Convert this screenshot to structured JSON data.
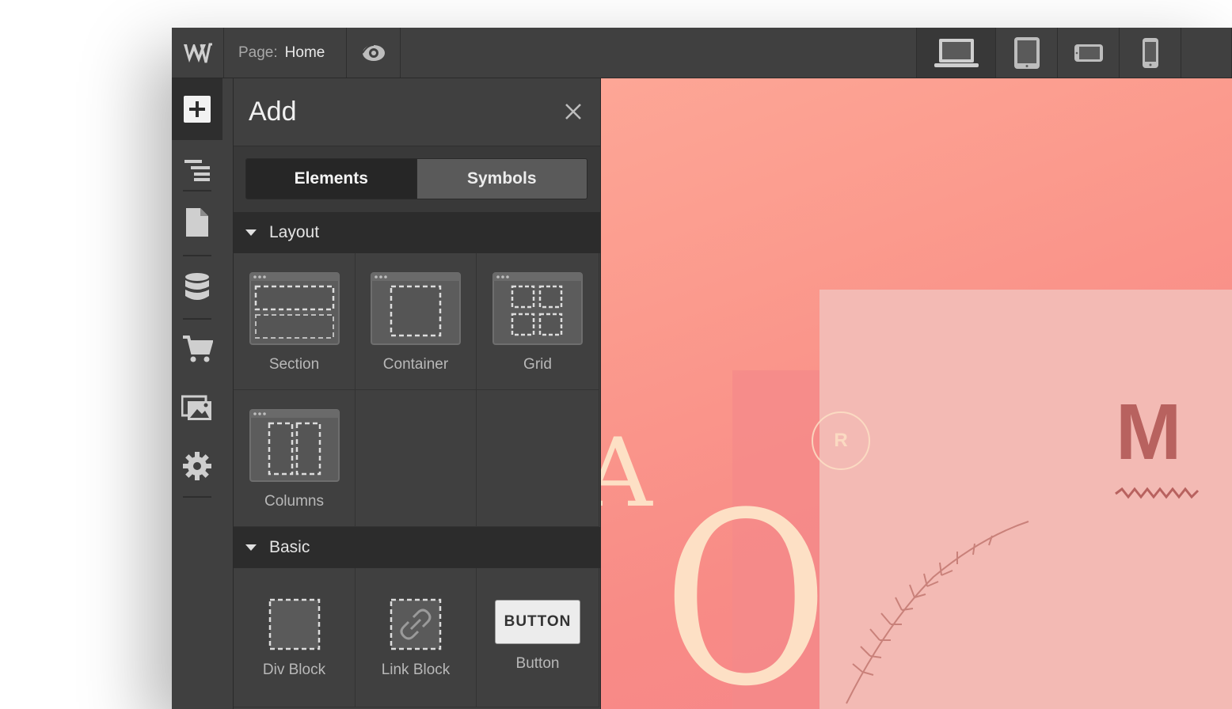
{
  "topbar": {
    "logo_text": "W",
    "page_label": "Page:",
    "page_name": "Home",
    "preview_icon": "eye-icon",
    "devices": [
      {
        "name": "desktop",
        "icon": "laptop-icon"
      },
      {
        "name": "tablet",
        "icon": "tablet-icon"
      },
      {
        "name": "mobile-landscape",
        "icon": "phone-landscape-icon"
      },
      {
        "name": "mobile-portrait",
        "icon": "phone-portrait-icon"
      }
    ]
  },
  "leftbar": {
    "items": [
      {
        "name": "add",
        "icon": "plus-icon"
      },
      {
        "name": "navigator",
        "icon": "navigator-icon"
      },
      {
        "name": "pages",
        "icon": "page-icon"
      },
      {
        "name": "cms",
        "icon": "database-icon"
      },
      {
        "name": "ecommerce",
        "icon": "cart-icon"
      },
      {
        "name": "assets",
        "icon": "images-icon"
      },
      {
        "name": "settings",
        "icon": "gear-icon"
      }
    ]
  },
  "panel": {
    "title": "Add",
    "tabs": {
      "elements": "Elements",
      "symbols": "Symbols"
    },
    "sections": {
      "layout": {
        "title": "Layout",
        "items": [
          "Section",
          "Container",
          "Grid",
          "Columns"
        ]
      },
      "basic": {
        "title": "Basic",
        "items": [
          "Div Block",
          "Link Block",
          "Button"
        ],
        "button_preview": "BUTTON"
      }
    }
  },
  "canvas": {
    "badge_text": "R",
    "letter_m": "M",
    "letter_o": "O",
    "letter_a": "A"
  },
  "colors": {
    "ui_dark": "#404040",
    "ui_darker": "#2c2c2c",
    "canvas_coral": "#fb9a8d",
    "canvas_pink": "#f3bab4",
    "cream": "#fde0c5"
  }
}
